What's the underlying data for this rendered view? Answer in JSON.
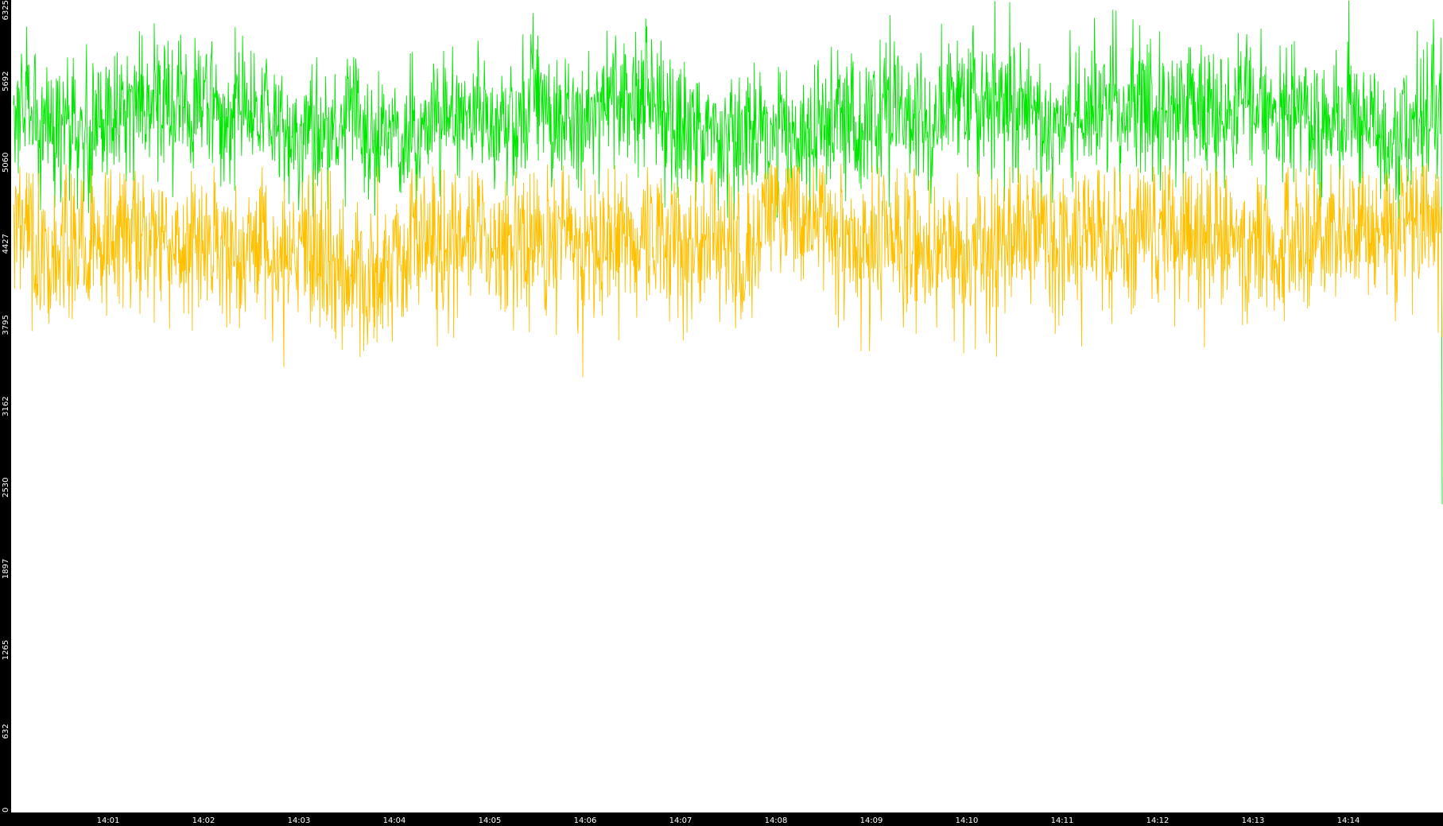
{
  "chart_data": {
    "type": "line",
    "title": "",
    "xlabel": "",
    "ylabel": "",
    "grid": false,
    "legend": "none",
    "background_color": "#000000",
    "plot_background_color": "#ffffff",
    "tick_label_color": "#ffffff",
    "y_tick_labels": [
      "0",
      "632",
      "1265",
      "1897",
      "2530",
      "3162",
      "3795",
      "4427",
      "5060",
      "5692",
      "6325"
    ],
    "ylim": [
      0,
      6325
    ],
    "x_tick_labels": [
      "14:01",
      "14:02",
      "14:03",
      "14:04",
      "14:05",
      "14:06",
      "14:07",
      "14:08",
      "14:09",
      "14:10",
      "14:11",
      "14:12",
      "14:13",
      "14:14"
    ],
    "xlim": [
      "14:00:01",
      "14:14:59"
    ],
    "series": [
      {
        "color": "#00e600",
        "mean": 5400,
        "min": 4600,
        "max": 6325,
        "final_value": 2400
      },
      {
        "color": "#ffc000",
        "mean": 4450,
        "min": 3100,
        "max": 5050,
        "final_value": 3700
      }
    ]
  }
}
